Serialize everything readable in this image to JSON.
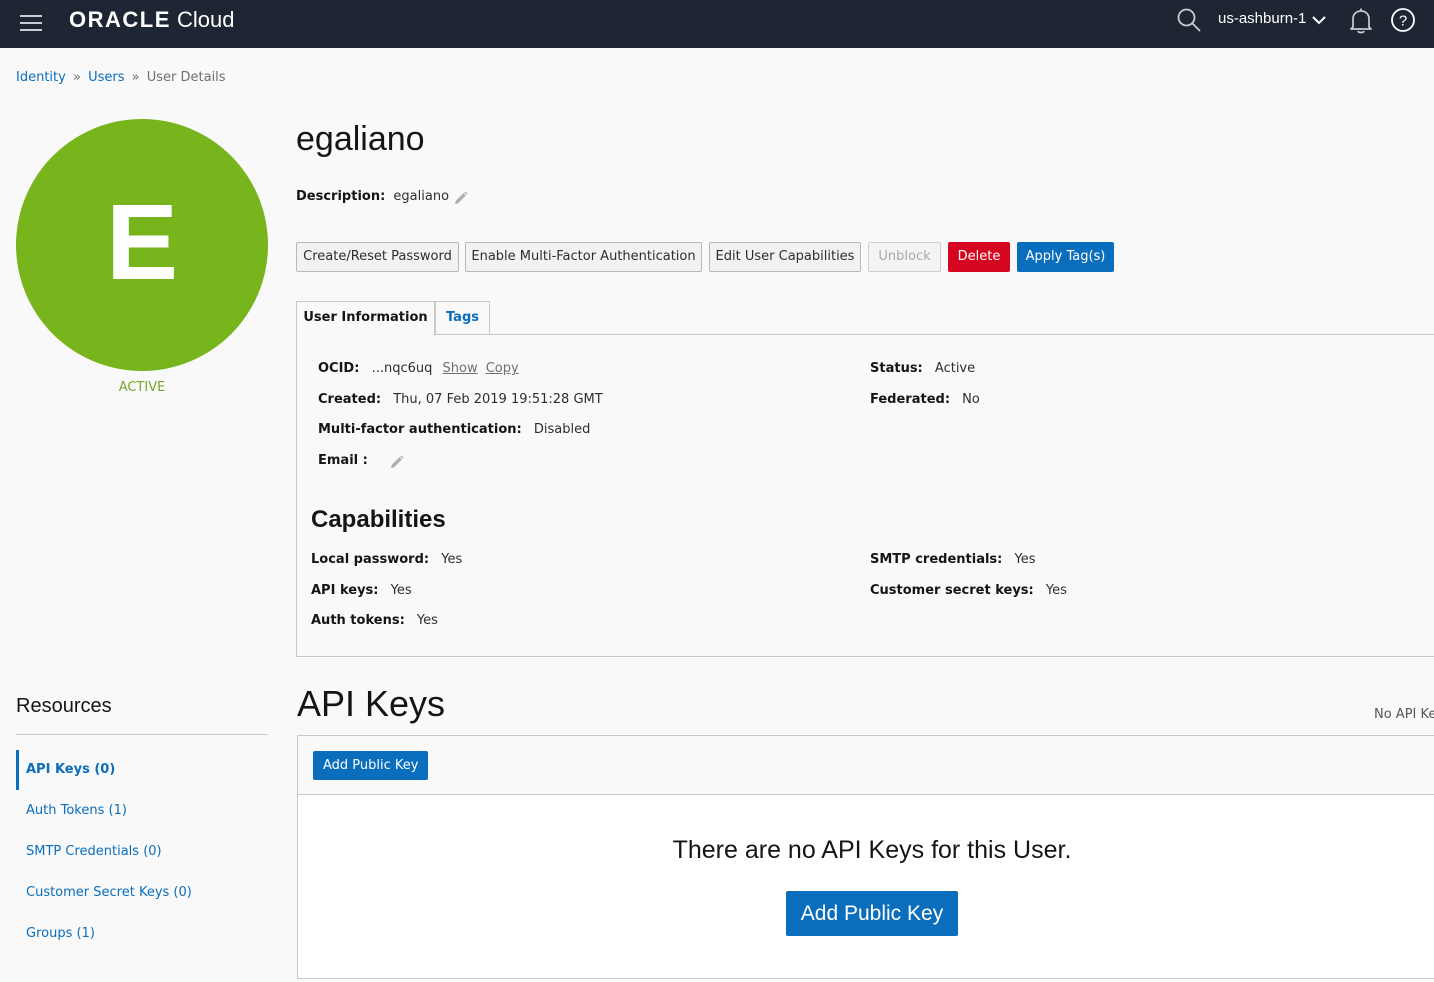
{
  "header": {
    "brand": "ORACLE",
    "product": "Cloud",
    "region": "us-ashburn-1"
  },
  "breadcrumb": {
    "items": [
      "Identity",
      "Users",
      "User Details"
    ],
    "separator": "»"
  },
  "user": {
    "initial": "E",
    "status": "ACTIVE",
    "name": "egaliano",
    "description_label": "Description:",
    "description": "egaliano",
    "avatar_color": "#78b41c"
  },
  "actions": {
    "create_reset_password": "Create/Reset Password",
    "enable_mfa": "Enable Multi-Factor Authentication",
    "edit_capabilities": "Edit User Capabilities",
    "unblock": "Unblock",
    "delete": "Delete",
    "apply_tags": "Apply Tag(s)"
  },
  "tabs": [
    "User Information",
    "Tags"
  ],
  "info": {
    "ocid_label": "OCID:",
    "ocid_value": "...nqc6uq",
    "ocid_show": "Show",
    "ocid_copy": "Copy",
    "created_label": "Created:",
    "created_value": "Thu, 07 Feb 2019 19:51:28 GMT",
    "mfa_label": "Multi-factor authentication:",
    "mfa_value": "Disabled",
    "email_label": "Email :",
    "status_label": "Status:",
    "status_value": "Active",
    "federated_label": "Federated:",
    "federated_value": "No"
  },
  "capabilities": {
    "title": "Capabilities",
    "local_password_label": "Local password:",
    "local_password_value": "Yes",
    "api_keys_label": "API keys:",
    "api_keys_value": "Yes",
    "auth_tokens_label": "Auth tokens:",
    "auth_tokens_value": "Yes",
    "smtp_label": "SMTP credentials:",
    "smtp_value": "Yes",
    "customer_secret_label": "Customer secret keys:",
    "customer_secret_value": "Yes"
  },
  "resources": {
    "title": "Resources",
    "items": [
      "API Keys (0)",
      "Auth Tokens (1)",
      "SMTP Credentials (0)",
      "Customer Secret Keys (0)",
      "Groups (1)"
    ]
  },
  "api_keys": {
    "title": "API Keys",
    "side_text": "No API Ke",
    "add_button": "Add Public Key",
    "empty_message": "There are no API Keys for this User.",
    "empty_add_button": "Add Public Key"
  },
  "colors": {
    "header_bg": "#1f2633",
    "link": "#0a6ebd",
    "primary": "#0a6ebd",
    "danger": "#d60520",
    "active_status": "#78a82a"
  }
}
